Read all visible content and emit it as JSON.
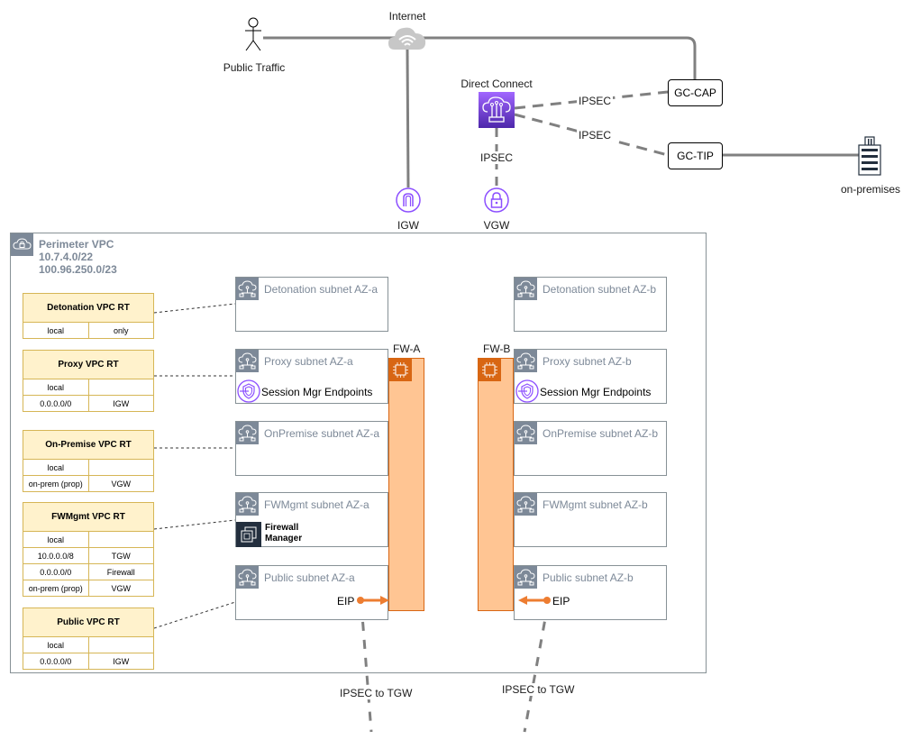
{
  "external": {
    "internet_label": "Internet",
    "public_traffic_label": "Public Traffic",
    "direct_connect_label": "Direct Connect",
    "gc_cap_label": "GC-CAP",
    "gc_tip_label": "GC-TIP",
    "on_premises_label": "on-premises",
    "igw_label": "IGW",
    "vgw_label": "VGW",
    "ipsec_labels": [
      "IPSEC",
      "IPSEC",
      "IPSEC"
    ],
    "ipsec_tgw_labels": [
      "IPSEC to TGW",
      "IPSEC to TGW"
    ]
  },
  "vpc": {
    "name": "Perimeter VPC",
    "cidrs": [
      "10.7.4.0/22",
      "100.96.250.0/23"
    ]
  },
  "route_tables": [
    {
      "title": "Detonation VPC RT",
      "rows": [
        [
          "local",
          "only"
        ]
      ]
    },
    {
      "title": "Proxy VPC RT",
      "rows": [
        [
          "local",
          ""
        ],
        [
          "0.0.0.0/0",
          "IGW"
        ]
      ]
    },
    {
      "title": "On-Premise VPC RT",
      "rows": [
        [
          "local",
          ""
        ],
        [
          "on-prem (prop)",
          "VGW"
        ]
      ]
    },
    {
      "title": "FWMgmt VPC RT",
      "rows": [
        [
          "local",
          ""
        ],
        [
          "10.0.0.0/8",
          "TGW"
        ],
        [
          "0.0.0.0/0",
          "Firewall"
        ],
        [
          "on-prem (prop)",
          "VGW"
        ]
      ]
    },
    {
      "title": "Public VPC RT",
      "rows": [
        [
          "local",
          ""
        ],
        [
          "0.0.0.0/0",
          "IGW"
        ]
      ]
    }
  ],
  "subnets_a": [
    {
      "title": "Detonation subnet AZ-a"
    },
    {
      "title": "Proxy subnet AZ-a",
      "content": "Session Mgr Endpoints"
    },
    {
      "title": "OnPremise subnet AZ-a"
    },
    {
      "title": "FWMgmt subnet AZ-a",
      "content_line1": "Firewall",
      "content_line2": "Manager"
    },
    {
      "title": "Public subnet AZ-a",
      "content": "EIP"
    }
  ],
  "subnets_b": [
    {
      "title": "Detonation subnet AZ-b"
    },
    {
      "title": "Proxy subnet AZ-b",
      "content": "Session Mgr Endpoints"
    },
    {
      "title": "OnPremise subnet AZ-b"
    },
    {
      "title": "FWMgmt subnet AZ-b"
    },
    {
      "title": "Public subnet AZ-b",
      "content": "EIP"
    }
  ],
  "firewalls": [
    {
      "label": "FW-A"
    },
    {
      "label": "FW-B"
    }
  ],
  "colors": {
    "line": "#808080",
    "route_table_header": "#fff2cc",
    "route_table_border": "#d6b656",
    "firewall_fill": "#ffc593",
    "firewall_accent": "#d86613",
    "aws_purple": "#8c4fff",
    "group_gray": "#7d8998",
    "eip_arrow": "#ed7d31"
  }
}
